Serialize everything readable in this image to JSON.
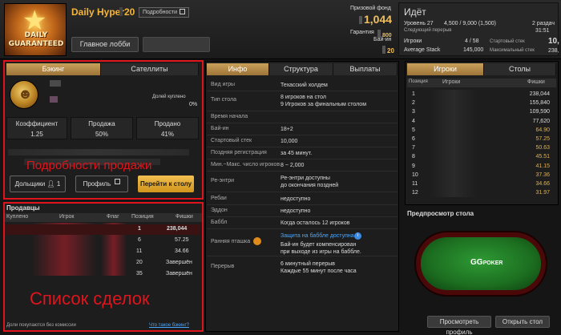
{
  "header": {
    "logo_line1": "DAILY",
    "logo_line2": "GUARANTEED",
    "tourney_name": "Daily Hyper",
    "tourney_buyin": "20",
    "details_label": "Подробности",
    "lobby_button": "Главное лобби",
    "prize_label": "Призовой фонд",
    "prize_value": "1,044",
    "guarantee_label": "Гарантия",
    "guarantee_value": "800",
    "buyin_label": "Бай-ин",
    "buyin_value": "20"
  },
  "status": {
    "title": "Идёт",
    "level": "Уровень 27",
    "blinds": "4,500 / 9,000 (1,500)",
    "next_label": "2 раздач",
    "next_break_label": "Следующий перерыв",
    "next_break_time": "31:51",
    "players_label": "Игроки",
    "players_value": "4 / 58",
    "avg_stack_label": "Average Stack",
    "avg_stack_value": "145,000",
    "start_stack_label": "Стартовый стек",
    "start_stack_value": "10,",
    "max_stack_label": "Максимальный стек",
    "max_stack_value": "238,",
    "right_big": "10"
  },
  "backing": {
    "tabs": [
      "Бэкинг",
      "Сателлиты"
    ],
    "sold_label": "Долей куплено",
    "sold_value": "0%",
    "stats": [
      {
        "label": "Коэффициент",
        "value": "1.25"
      },
      {
        "label": "Продажа",
        "value": "50%"
      },
      {
        "label": "Продано",
        "value": "41%"
      }
    ],
    "overlay_title": "Подробности продажи",
    "buttons": {
      "backers": "Дольщики",
      "backers_count": "1",
      "profile": "Профиль",
      "go_table": "Перейти к столу"
    }
  },
  "sellers": {
    "title": "Продавцы",
    "columns": [
      "Куплено",
      "Игрок",
      "Флаг",
      "Позиция",
      "Фишки"
    ],
    "rows": [
      {
        "position": "1",
        "chips": "238,044"
      },
      {
        "position": "6",
        "chips": "57.25"
      },
      {
        "position": "11",
        "chips": "34.66"
      },
      {
        "position": "20",
        "chips": "Завершён"
      },
      {
        "position": "35",
        "chips": "Завершён"
      }
    ],
    "overlay_title": "Список сделок",
    "footer_text": "Доли покупаются без комиссии",
    "footer_link": "Что такое бэкинг?"
  },
  "info": {
    "tabs": [
      "Инфо",
      "Структура",
      "Выплаты"
    ],
    "rows": [
      {
        "k": "Вид игры",
        "v": "Техасский холдем"
      },
      {
        "k": "Тип стола",
        "v": "8 игроков на стол\n9 Игроков за финальным столом"
      },
      {
        "k": "Время начала",
        "v": ""
      },
      {
        "k": "Бай-ин",
        "v": "18+2"
      },
      {
        "k": "Стартовый стек",
        "v": "10,000"
      },
      {
        "k": "Поздняя регистрация",
        "v": "за 45 минут."
      },
      {
        "k": "Мин.~Макс. число игроков",
        "v": "8 ~ 2,000"
      },
      {
        "k": "Ре-энтри",
        "v": "Ре-энтри доступны\nдо окончания поздней"
      },
      {
        "k": "Ребаи",
        "v": "недоступно"
      },
      {
        "k": "Эддон",
        "v": "недоступно"
      },
      {
        "k": "Баббл",
        "v": "Когда осталось 12 игроков"
      }
    ],
    "early_bird_label": "Ранняя пташка",
    "bubble_protect": "Защита на баббле доступна",
    "bubble_desc": "Бай-ин будет компенсирован\nпри выходе из игры на баббле.",
    "breaks_label": "Перерыв",
    "breaks_value": "6 минутный перерыв\nКаждые 55 минут после часа"
  },
  "players": {
    "tabs": [
      "Игроки",
      "Столы"
    ],
    "columns": [
      "Позиция",
      "Игроки",
      "Фишки"
    ],
    "rows": [
      {
        "pos": "1",
        "chips": "238,044",
        "gold": false
      },
      {
        "pos": "2",
        "chips": "155,840",
        "gold": false
      },
      {
        "pos": "3",
        "chips": "109,590",
        "gold": false
      },
      {
        "pos": "4",
        "chips": "77,620",
        "gold": false
      },
      {
        "pos": "5",
        "chips": "64.90",
        "gold": true
      },
      {
        "pos": "6",
        "chips": "57.25",
        "gold": true
      },
      {
        "pos": "7",
        "chips": "50.63",
        "gold": true
      },
      {
        "pos": "8",
        "chips": "45.51",
        "gold": true
      },
      {
        "pos": "9",
        "chips": "41.15",
        "gold": true
      },
      {
        "pos": "10",
        "chips": "37.36",
        "gold": true
      },
      {
        "pos": "11",
        "chips": "34.66",
        "gold": true
      },
      {
        "pos": "12",
        "chips": "31.97",
        "gold": true
      }
    ],
    "preview_title": "Предпросмотр стола",
    "gg_logo_gg": "GG",
    "gg_logo_text": "POKER",
    "btn_profile": "Просмотреть профиль",
    "btn_open": "Открыть стол"
  },
  "colors": {
    "accent_gold": "#c9a05a",
    "annotation_red": "#e0141c",
    "chip_gold": "#e8b040"
  }
}
